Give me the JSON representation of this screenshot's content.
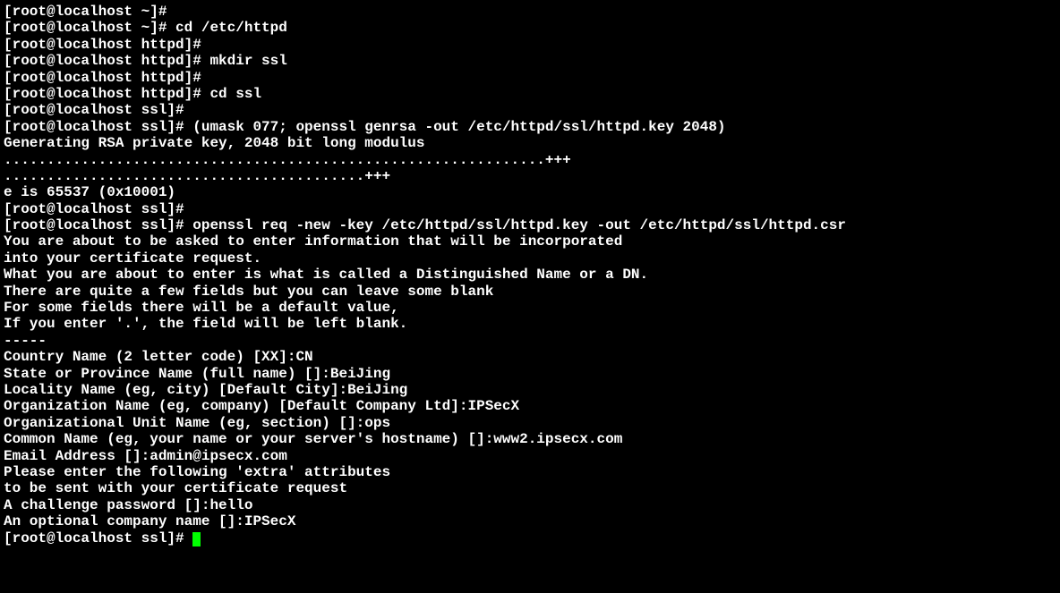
{
  "lines": [
    "[root@localhost ~]#",
    "[root@localhost ~]# cd /etc/httpd",
    "[root@localhost httpd]#",
    "[root@localhost httpd]# mkdir ssl",
    "[root@localhost httpd]#",
    "[root@localhost httpd]# cd ssl",
    "[root@localhost ssl]#",
    "[root@localhost ssl]# (umask 077; openssl genrsa -out /etc/httpd/ssl/httpd.key 2048)",
    "Generating RSA private key, 2048 bit long modulus",
    "...............................................................+++",
    "..........................................+++",
    "e is 65537 (0x10001)",
    "[root@localhost ssl]#",
    "[root@localhost ssl]# openssl req -new -key /etc/httpd/ssl/httpd.key -out /etc/httpd/ssl/httpd.csr",
    "You are about to be asked to enter information that will be incorporated",
    "into your certificate request.",
    "What you are about to enter is what is called a Distinguished Name or a DN.",
    "There are quite a few fields but you can leave some blank",
    "For some fields there will be a default value,",
    "If you enter '.', the field will be left blank.",
    "-----",
    "Country Name (2 letter code) [XX]:CN",
    "State or Province Name (full name) []:BeiJing",
    "Locality Name (eg, city) [Default City]:BeiJing",
    "Organization Name (eg, company) [Default Company Ltd]:IPSecX",
    "Organizational Unit Name (eg, section) []:ops",
    "Common Name (eg, your name or your server's hostname) []:www2.ipsecx.com",
    "Email Address []:admin@ipsecx.com",
    "",
    "Please enter the following 'extra' attributes",
    "to be sent with your certificate request",
    "A challenge password []:hello",
    "An optional company name []:IPSecX",
    "[root@localhost ssl]# "
  ],
  "cursor_visible": true
}
